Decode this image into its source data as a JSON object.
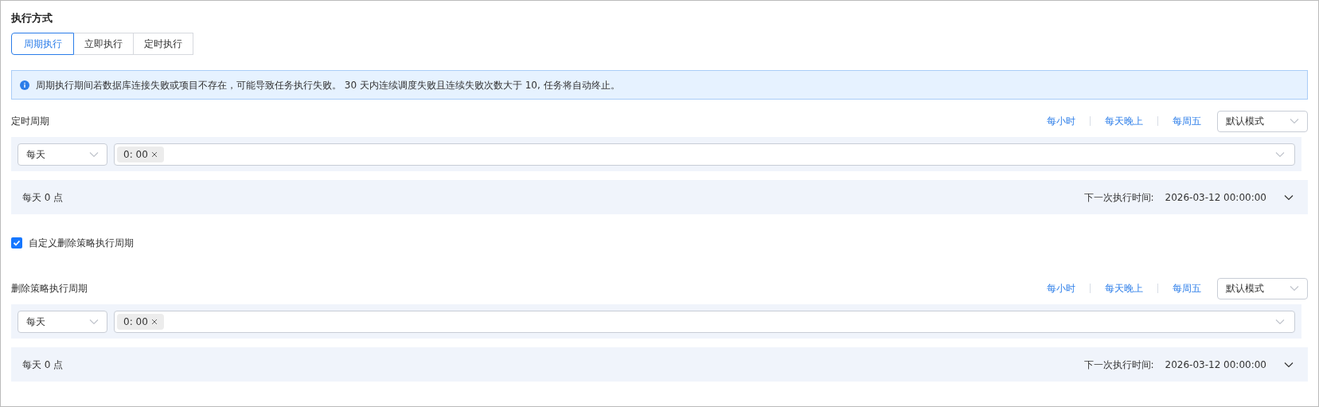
{
  "title": "执行方式",
  "tabs": [
    {
      "label": "周期执行",
      "selected": true
    },
    {
      "label": "立即执行",
      "selected": false
    },
    {
      "label": "定时执行",
      "selected": false
    }
  ],
  "alert": "周期执行期间若数据库连接失败或项目不存在，可能导致任务执行失败。 30 天内连续调度失败且连续失败次数大于 10, 任务将自动终止。",
  "schedule": {
    "label": "定时周期",
    "presets": [
      "每小时",
      "每天晚上",
      "每周五"
    ],
    "mode": "默认模式",
    "frequency": "每天",
    "times": [
      "0: 00"
    ],
    "summary": "每天 0 点",
    "next_label": "下一次执行时间:",
    "next_value": "2026-03-12 00:00:00"
  },
  "custom_checkbox": {
    "label": "自定义删除策略执行周期",
    "checked": true
  },
  "delete_schedule": {
    "label": "删除策略执行周期",
    "presets": [
      "每小时",
      "每天晚上",
      "每周五"
    ],
    "mode": "默认模式",
    "frequency": "每天",
    "times": [
      "0: 00"
    ],
    "summary": "每天 0 点",
    "next_label": "下一次执行时间:",
    "next_value": "2026-03-12 00:00:00"
  }
}
